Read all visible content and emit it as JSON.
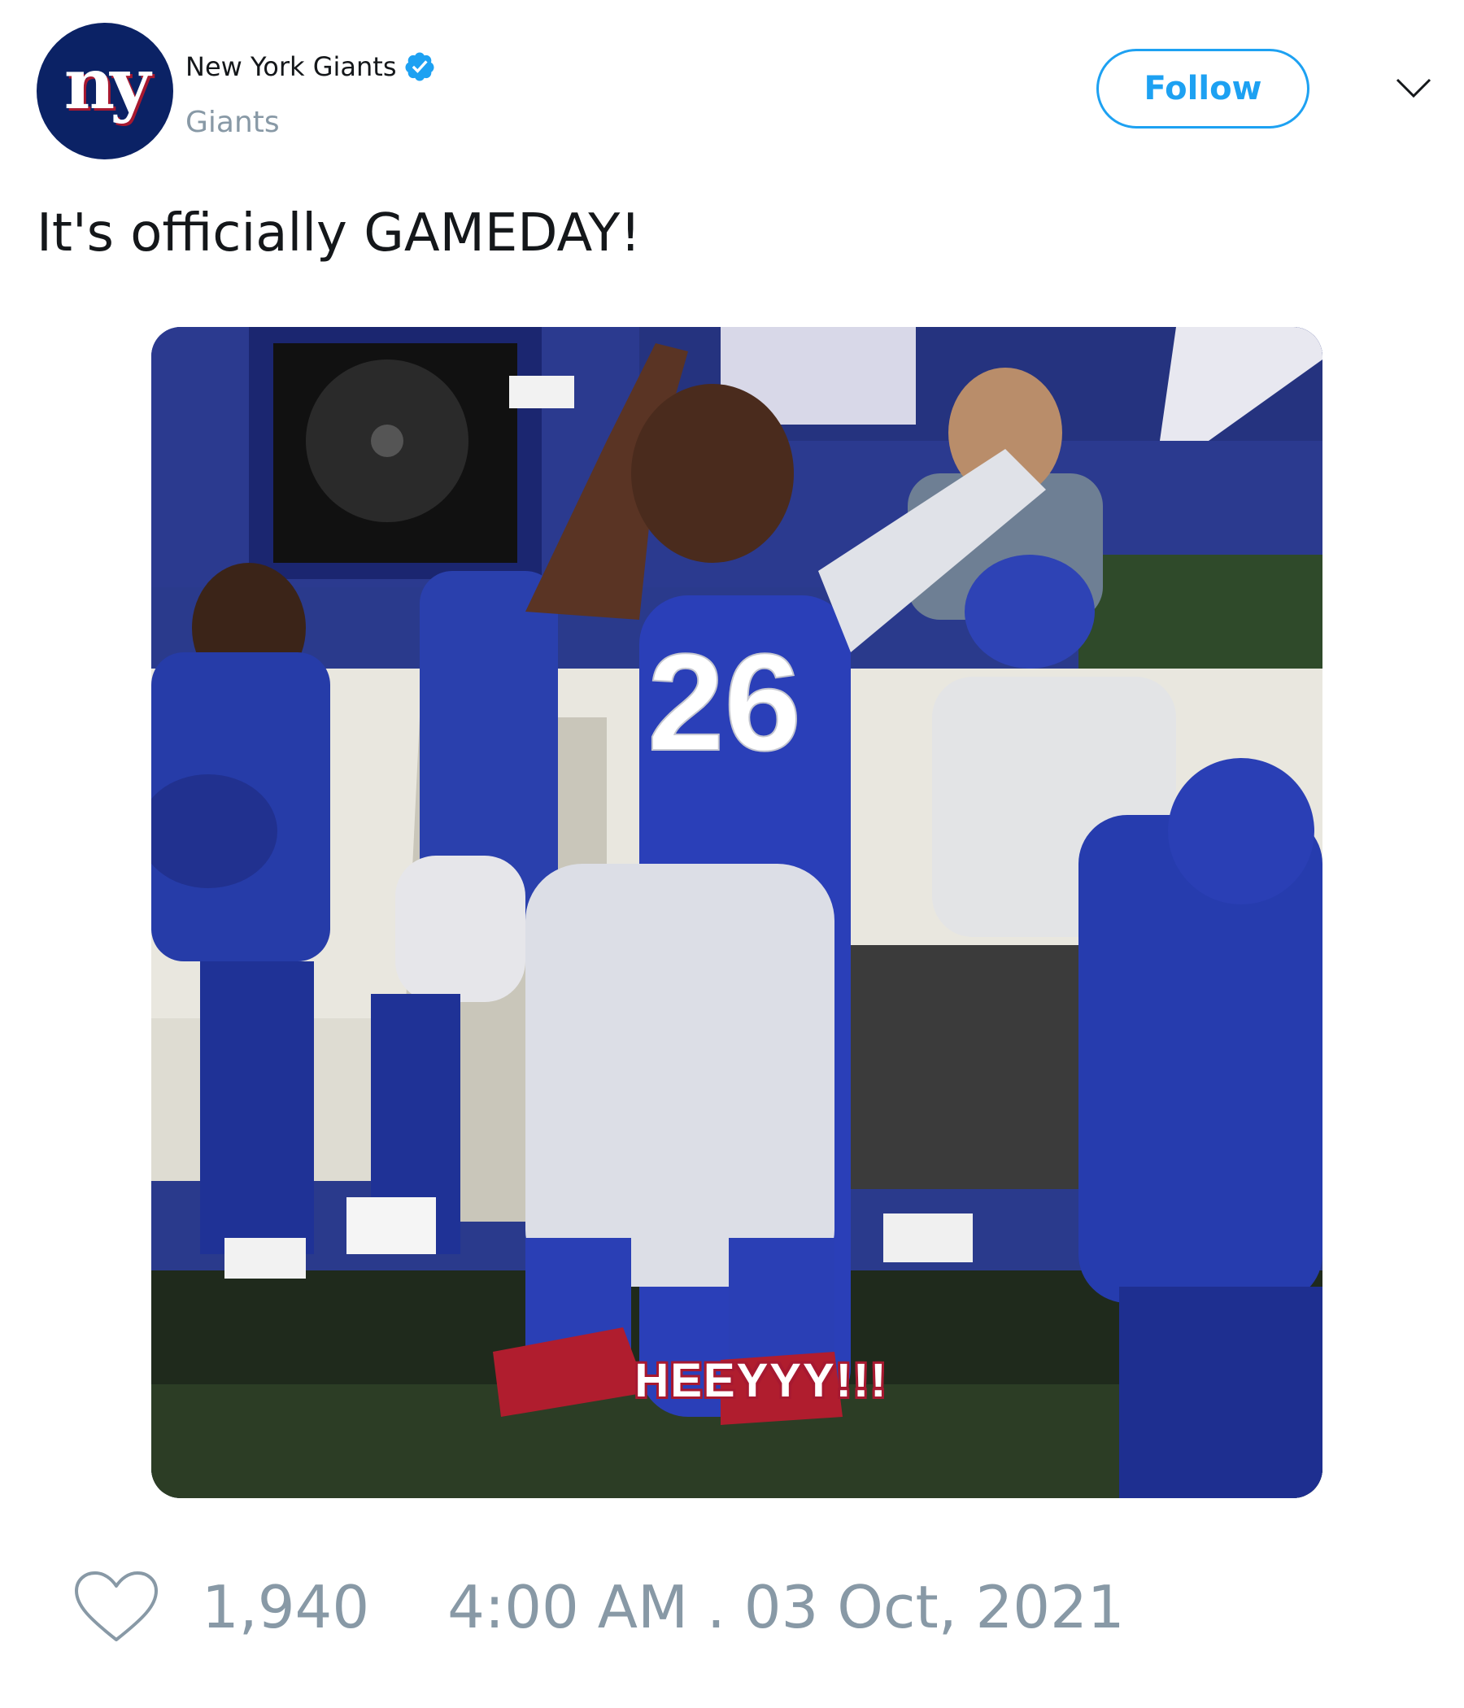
{
  "user": {
    "display_name": "New York Giants",
    "handle": "Giants",
    "avatar_text": "ny",
    "verified": true
  },
  "actions": {
    "follow_label": "Follow"
  },
  "tweet": {
    "text": "It's officially GAMEDAY!",
    "media_caption": "HEEYYY!!!",
    "likes": "1,940",
    "timestamp": "4:00 AM . 03 Oct, 2021"
  },
  "icons": {
    "verified": "verified-badge-icon",
    "chevron": "chevron-down-icon",
    "like": "heart-icon"
  },
  "colors": {
    "brand_blue": "#1da1f2",
    "giants_blue": "#0b2265",
    "giants_red": "#a71930",
    "muted_text": "#8899a6",
    "body_text": "#14171a"
  }
}
